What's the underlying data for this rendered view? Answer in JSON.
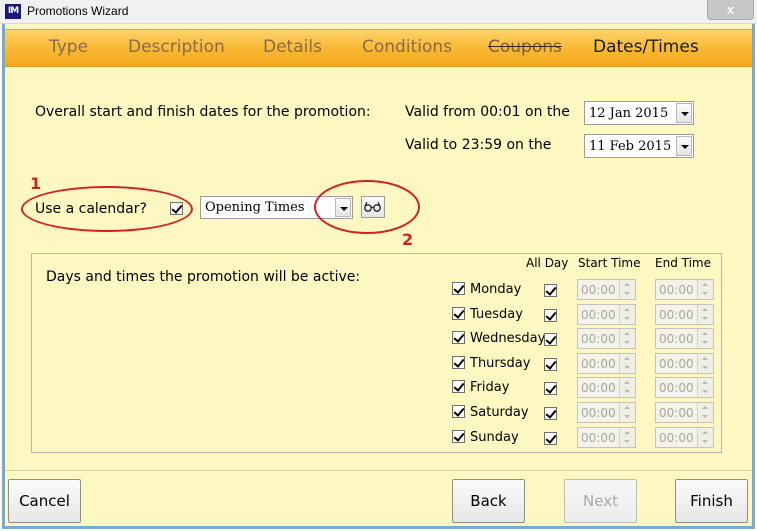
{
  "window": {
    "title": "Promotions Wizard",
    "app_icon_text": "IM",
    "close_symbol": "x"
  },
  "tabs": [
    {
      "label": "Type"
    },
    {
      "label": "Description"
    },
    {
      "label": "Details"
    },
    {
      "label": "Conditions"
    },
    {
      "label": "Coupons",
      "strikethrough": true
    },
    {
      "label": "Dates/Times",
      "active": true
    }
  ],
  "dates": {
    "overall_label": "Overall start and finish dates for the promotion:",
    "valid_from_label": "Valid from 00:01 on the",
    "valid_from_value": "12 Jan 2015",
    "valid_to_label": "Valid to 23:59 on the",
    "valid_to_value": "11 Feb 2015"
  },
  "calendar": {
    "label": "Use a calendar?",
    "checked": true,
    "selected": "Opening Times",
    "view_icon": "glasses-icon"
  },
  "annotations": {
    "one": "1",
    "two": "2"
  },
  "schedule": {
    "heading": "Days and times the promotion will be active:",
    "col_allday": "All Day",
    "col_start": "Start Time",
    "col_end": "End Time",
    "days": [
      {
        "name": "Monday",
        "active": true,
        "all_day": true,
        "start": "00:00",
        "end": "00:00"
      },
      {
        "name": "Tuesday",
        "active": true,
        "all_day": true,
        "start": "00:00",
        "end": "00:00"
      },
      {
        "name": "Wednesday",
        "active": true,
        "all_day": true,
        "start": "00:00",
        "end": "00:00"
      },
      {
        "name": "Thursday",
        "active": true,
        "all_day": true,
        "start": "00:00",
        "end": "00:00"
      },
      {
        "name": "Friday",
        "active": true,
        "all_day": true,
        "start": "00:00",
        "end": "00:00"
      },
      {
        "name": "Saturday",
        "active": true,
        "all_day": true,
        "start": "00:00",
        "end": "00:00"
      },
      {
        "name": "Sunday",
        "active": true,
        "all_day": true,
        "start": "00:00",
        "end": "00:00"
      }
    ]
  },
  "buttons": {
    "cancel": "Cancel",
    "back": "Back",
    "next": "Next",
    "finish": "Finish"
  },
  "colors": {
    "accent_orange": "#f7b731",
    "panel_yellow": "#fdf8c2",
    "annotation_red": "#d42020",
    "frame_blue": "#7aa8d4"
  }
}
